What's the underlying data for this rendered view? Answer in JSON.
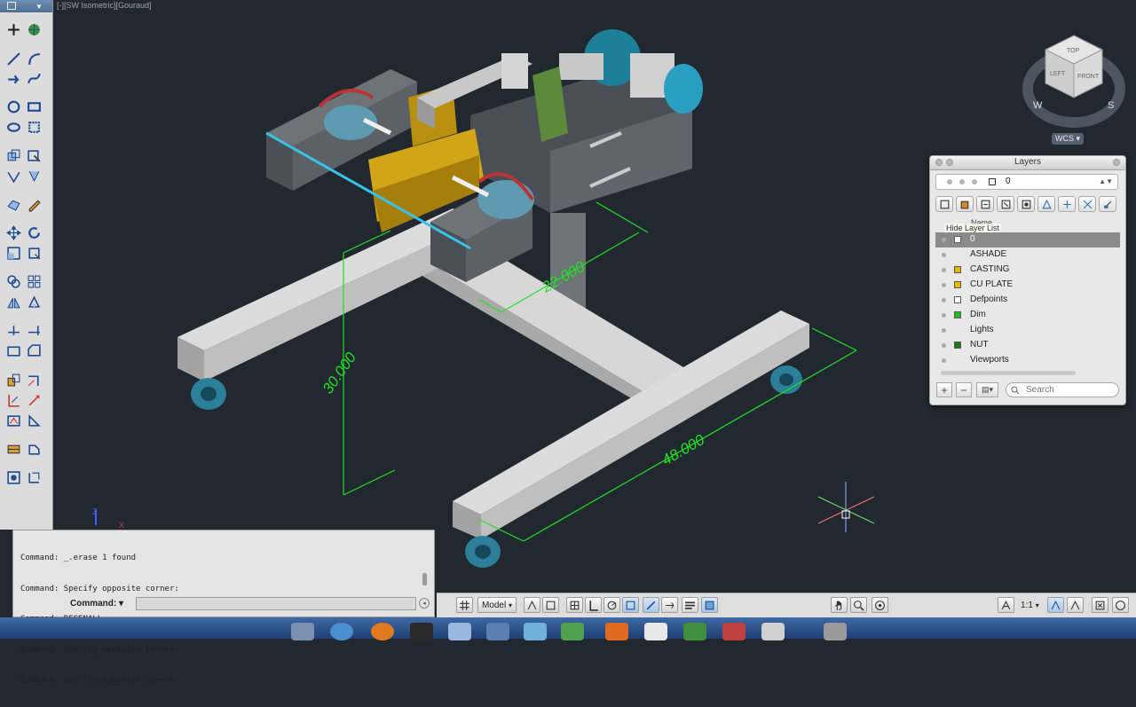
{
  "viewport": {
    "label": "[-][SW Isometric][Gouraud]",
    "dimensions": [
      "22.000",
      "30.000",
      "48.000"
    ]
  },
  "viewcube": {
    "faces": [
      "TOP",
      "LEFT",
      "FRONT"
    ],
    "compass": [
      "W",
      "S"
    ],
    "wcs_label": "WCS"
  },
  "layers_panel": {
    "title": "Layers",
    "current_layer": "0",
    "name_header": "Name",
    "tooltip": "Hide Layer List",
    "layers": [
      {
        "name": "0",
        "color": "#ffffff",
        "selected": true
      },
      {
        "name": "ASHADE",
        "color": "",
        "selected": false
      },
      {
        "name": "CASTING",
        "color": "#e6b800",
        "selected": false
      },
      {
        "name": "CU PLATE",
        "color": "#e6b800",
        "selected": false
      },
      {
        "name": "Defpoints",
        "color": "#ffffff",
        "selected": false
      },
      {
        "name": "Dim",
        "color": "#22bb22",
        "selected": false
      },
      {
        "name": "Lights",
        "color": "",
        "selected": false
      },
      {
        "name": "NUT",
        "color": "#1a7a1a",
        "selected": false
      },
      {
        "name": "Viewports",
        "color": "",
        "selected": false
      }
    ],
    "add_label": "+",
    "remove_label": "−",
    "search_placeholder": "Search"
  },
  "command_window": {
    "history": [
      "Command: _.erase 1 found",
      "Command: Specify opposite corner:",
      "Command: REGENALL",
      "Command: Specify opposite corner:",
      "Command: Specify opposite corner:"
    ],
    "prompt": "Command:",
    "input_value": ""
  },
  "status_bar": {
    "model_label": "Model",
    "scale_label": "1:1"
  },
  "colors": {
    "viewport_bg": "#212830",
    "dimension_green": "#22e022",
    "casting_gold": "#c99a12",
    "motor_teal": "#1d7f98",
    "frame_gray": "#c5c5c5"
  }
}
